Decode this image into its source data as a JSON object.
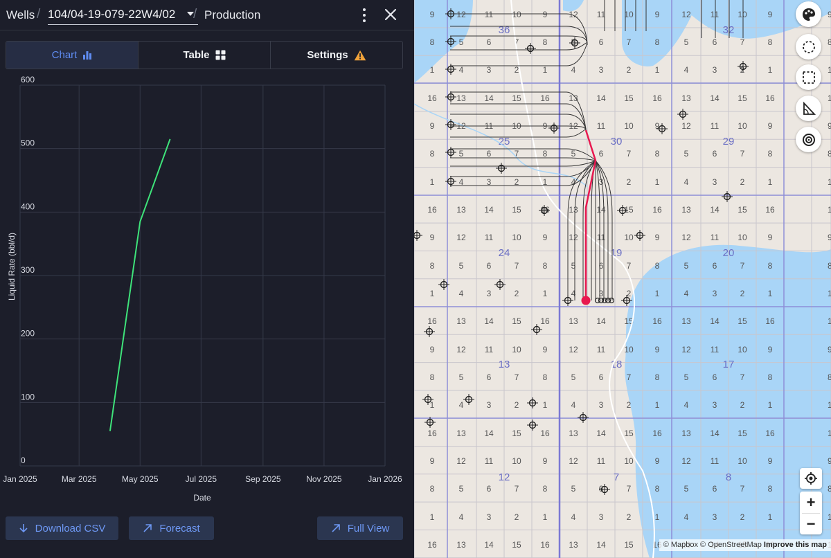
{
  "header": {
    "root": "Wells",
    "well_id": "104/04-19-079-22W4/02",
    "section": "Production"
  },
  "tabs": [
    {
      "label": "Chart",
      "icon": "bar-chart-icon",
      "active": true
    },
    {
      "label": "Table",
      "icon": "grid-icon",
      "active": false
    },
    {
      "label": "Settings",
      "icon": "warning-icon",
      "active": false
    }
  ],
  "colors": {
    "accent": "#5f8cf2",
    "series": "#3ee37a",
    "warning": "#f0a23a",
    "water": "#a9d5f7",
    "selected_well": "#e8184f"
  },
  "chart_data": {
    "type": "line",
    "title": "",
    "xlabel": "Date",
    "ylabel": "Liquid Rate (bbl/d)",
    "ylim": [
      0,
      600
    ],
    "yticks": [
      0,
      100,
      200,
      300,
      400,
      500,
      600
    ],
    "xlim": [
      "2025-01-01",
      "2026-01-01"
    ],
    "xticks": [
      {
        "date": "2025-01-01",
        "label": "Jan 2025"
      },
      {
        "date": "2025-03-01",
        "label": "Mar 2025"
      },
      {
        "date": "2025-05-01",
        "label": "May 2025"
      },
      {
        "date": "2025-07-01",
        "label": "Jul 2025"
      },
      {
        "date": "2025-09-01",
        "label": "Sep 2025"
      },
      {
        "date": "2025-11-01",
        "label": "Nov 2025"
      },
      {
        "date": "2026-01-01",
        "label": "Jan 2026"
      }
    ],
    "grid": true,
    "series": [
      {
        "x": [
          "2025-04-01",
          "2025-05-01",
          "2025-05-31"
        ],
        "y": [
          55,
          385,
          515
        ]
      }
    ]
  },
  "footer": {
    "download": "Download CSV",
    "forecast": "Forecast",
    "full_view": "Full View"
  },
  "map": {
    "attribution": "© Mapbox © OpenStreetMap",
    "improve": "Improve this map",
    "section_labels": [
      {
        "label": "36"
      },
      {
        "label": "32"
      },
      {
        "label": "25"
      },
      {
        "label": "30"
      },
      {
        "label": "29"
      },
      {
        "label": "24"
      },
      {
        "label": "19"
      },
      {
        "label": "20"
      },
      {
        "label": "13"
      },
      {
        "label": "18"
      },
      {
        "label": "17"
      },
      {
        "label": "12"
      },
      {
        "label": "7"
      },
      {
        "label": "8"
      }
    ],
    "lsd_rows": [
      [
        "9",
        "12",
        "11",
        "10",
        "9",
        "12",
        "11",
        "10",
        "9",
        "12",
        "11",
        "10",
        "9"
      ],
      [
        "8",
        "5",
        "6",
        "7",
        "8",
        "5",
        "6",
        "7",
        "8",
        "5",
        "6",
        "7",
        "8"
      ],
      [
        "1",
        "4",
        "3",
        "2",
        "1",
        "4",
        "3",
        "2",
        "1",
        "4",
        "3",
        "2",
        "1"
      ],
      [
        "16",
        "13",
        "14",
        "15",
        "16",
        "13",
        "14",
        "15",
        "16",
        "13",
        "14",
        "15",
        "16"
      ]
    ]
  }
}
